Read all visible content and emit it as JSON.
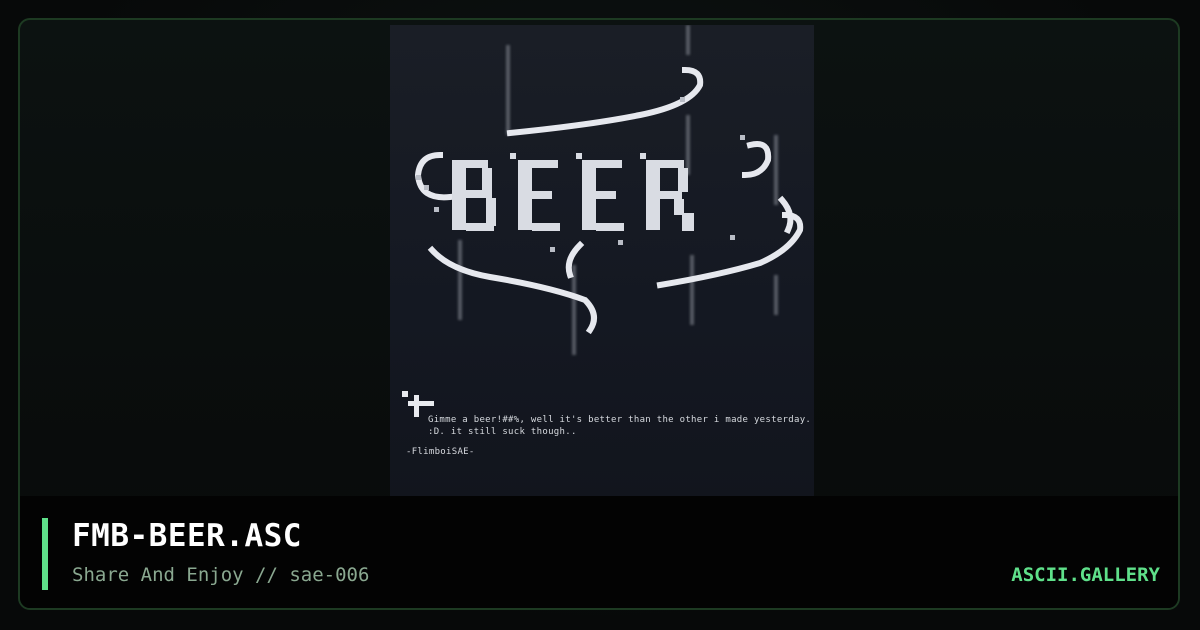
{
  "artwork": {
    "caption_line1": "Gimme a beer!##%, well it's better than the other i made yesterday.",
    "caption_line2": ":D. it still suck though..",
    "signature": "-FlimboiSAE-"
  },
  "footer": {
    "title": "FMB-BEER.ASC",
    "subtitle": "Share And Enjoy // sae-006",
    "site": "ASCII.GALLERY"
  },
  "colors": {
    "accent": "#5fe08a",
    "background": "#07090a",
    "artwork_bg": "#161a22",
    "ink": "#e8eaef"
  }
}
